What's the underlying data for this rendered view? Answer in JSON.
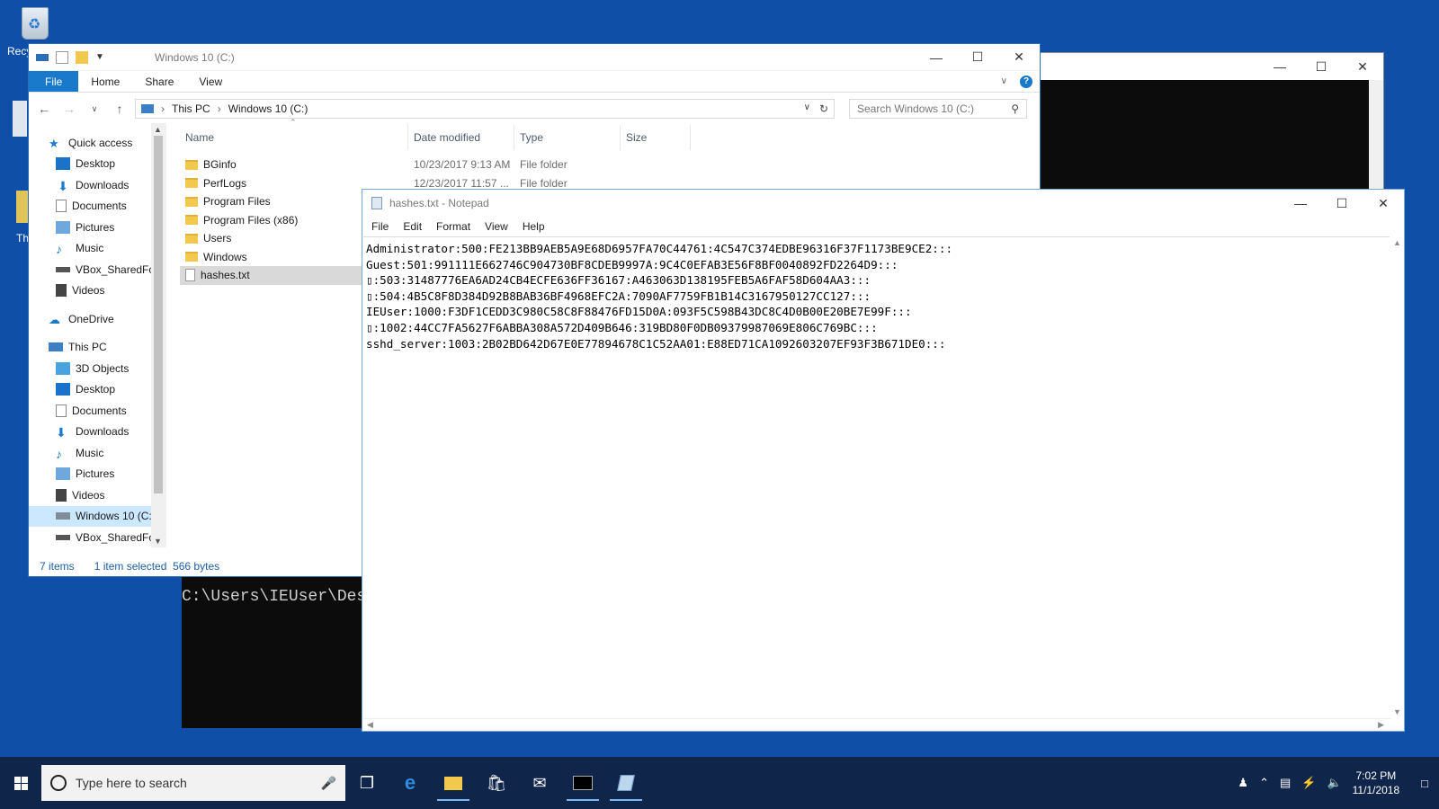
{
  "desktop": {
    "recycle_bin_label": "Recy",
    "frag_label": "Th"
  },
  "explorer": {
    "title": "Windows 10 (C:)",
    "ribbon_tabs": [
      "File",
      "Home",
      "Share",
      "View"
    ],
    "breadcrumb": [
      "This PC",
      "Windows 10 (C:)"
    ],
    "search_placeholder": "Search Windows 10 (C:)",
    "nav": {
      "quick_access": "Quick access",
      "quick_items": [
        "Desktop",
        "Downloads",
        "Documents",
        "Pictures",
        "Music",
        "VBox_SharedFolder",
        "Videos"
      ],
      "onedrive": "OneDrive",
      "this_pc": "This PC",
      "pc_items": [
        "3D Objects",
        "Desktop",
        "Documents",
        "Downloads",
        "Music",
        "Pictures",
        "Videos",
        "Windows 10 (C:)",
        "VBox_SharedFolder"
      ]
    },
    "columns": [
      "Name",
      "Date modified",
      "Type",
      "Size"
    ],
    "files": [
      {
        "name": "BGinfo",
        "date": "10/23/2017 9:13 AM",
        "type": "File folder"
      },
      {
        "name": "PerfLogs",
        "date": "12/23/2017 11:57 ...",
        "type": "File folder"
      },
      {
        "name": "Program Files",
        "date": "",
        "type": ""
      },
      {
        "name": "Program Files (x86)",
        "date": "",
        "type": ""
      },
      {
        "name": "Users",
        "date": "",
        "type": ""
      },
      {
        "name": "Windows",
        "date": "",
        "type": ""
      },
      {
        "name": "hashes.txt",
        "date": "",
        "type": ""
      }
    ],
    "status": {
      "items": "7 items",
      "selected": "1 item selected",
      "size": "566 bytes"
    }
  },
  "cmd": {
    "prompt": "C:\\Users\\IEUser\\Des"
  },
  "notepad": {
    "title": "hashes.txt - Notepad",
    "menu": [
      "File",
      "Edit",
      "Format",
      "View",
      "Help"
    ],
    "lines": [
      "Administrator:500:FE213BB9AEB5A9E68D6957FA70C44761:4C547C374EDBE96316F37F1173BE9CE2:::",
      "Guest:501:991111E662746C904730BF8CDEB9997A:9C4C0EFAB3E56F8BF0040892FD2264D9:::",
      "▯:503:31487776EA6AD24CB4ECFE636FF36167:A463063D138195FEB5A6FAF58D604AA3:::",
      "▯:504:4B5C8F8D384D92B8BAB36BF4968EFC2A:7090AF7759FB1B14C3167950127CC127:::",
      "IEUser:1000:F3DF1CEDD3C980C58C8F88476FD15D0A:093F5C598B43DC8C4D0B00E20BE7E99F:::",
      "▯:1002:44CC7FA5627F6ABBA308A572D409B646:319BD80F0DB09379987069E806C769BC:::",
      "sshd_server:1003:2B02BD642D67E0E77894678C1C52AA01:E88ED71CA1092603207EF93F3B671DE0:::"
    ]
  },
  "taskbar": {
    "search_placeholder": "Type here to search",
    "time": "7:02 PM",
    "date": "11/1/2018"
  }
}
